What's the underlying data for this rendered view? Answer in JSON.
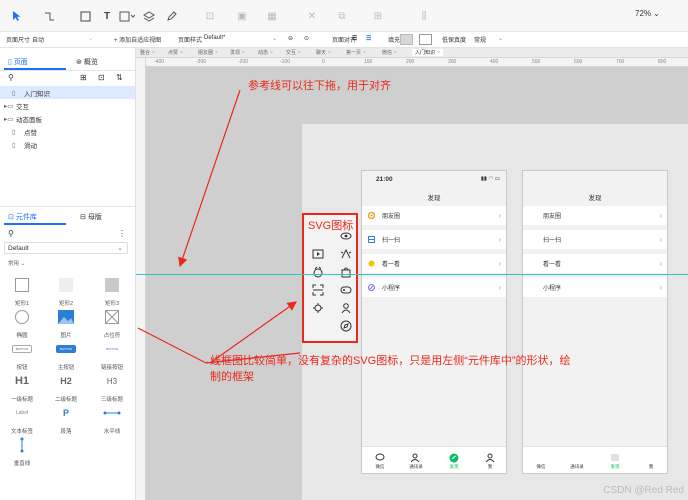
{
  "toolbar": {
    "zoom": "72%"
  },
  "propbar": {
    "page_size_label": "页面尺寸",
    "page_size_value": "自动",
    "add_adaptive_view": "+ 添加自适应视图",
    "page_style_label": "页面样式",
    "page_style_value": "Default*",
    "page_align_label": "页面对齐",
    "fill_label": "填充",
    "low_fidelity_label": "低保真度",
    "low_fidelity_value": "常规"
  },
  "left": {
    "tab_pages": "页面",
    "tab_outline": "概览",
    "tree": [
      {
        "label": "入门知识",
        "indent": 1,
        "selected": true,
        "kind": "page"
      },
      {
        "label": "交互",
        "indent": 0,
        "selected": false,
        "kind": "folder"
      },
      {
        "label": "动态面板",
        "indent": 0,
        "selected": false,
        "kind": "folder"
      },
      {
        "label": "点赞",
        "indent": 1,
        "selected": false,
        "kind": "page"
      },
      {
        "label": "滑动",
        "indent": 1,
        "selected": false,
        "kind": "page"
      }
    ],
    "tab_library": "元件库",
    "tab_masters": "母版",
    "library_select": "Default",
    "section_common": "常用",
    "widgets": [
      "矩形1",
      "矩形2",
      "矩形3",
      "椭圆",
      "图片",
      "占位符",
      "按钮",
      "主按钮",
      "链接按钮",
      "一级标题",
      "二级标题",
      "三级标题",
      "文本标签",
      "段落",
      "水平线",
      "垂直线"
    ],
    "widget_glyphs": {
      "h1": "H1",
      "h2": "H2",
      "h3": "H3",
      "label": "Label",
      "para": "P",
      "btn": "BUTTON"
    }
  },
  "canvas": {
    "page_tabs": [
      "整合",
      "点赞",
      "朋友圈",
      "发现",
      "动态",
      "交互",
      "聊天",
      "第一页",
      "微信",
      "入门知识"
    ],
    "ruler_numbers": [
      "-400",
      "-300",
      "-200",
      "-100",
      "0",
      "100",
      "200",
      "300",
      "400",
      "500",
      "600",
      "700",
      "800"
    ],
    "annotation_top": "参考线可以往下拖，用于对齐",
    "annotation_bottom_line1": "线框图比较简单，没有复杂的SVG图标，只是用左侧“元件库中”的形状，绘",
    "annotation_bottom_line2": "制的框架",
    "svg_label": "SVG图标",
    "phone1": {
      "time": "21:00",
      "title": "发现",
      "rows": [
        "朋友圈",
        "扫一扫",
        "看一看",
        "小程序"
      ],
      "nav": [
        "微信",
        "通讯录",
        "发现",
        "我"
      ]
    },
    "phone2": {
      "title": "发现",
      "rows": [
        "朋友圈",
        "扫一扫",
        "看一看",
        "小程序"
      ],
      "nav": [
        "微信",
        "通讯录",
        "发现",
        "我"
      ]
    },
    "watermark": "CSDN @Red Red"
  },
  "colors": {
    "accent": "#1e6fff",
    "annotation": "#e8291c",
    "guide": "#2ec5ce",
    "green": "#07c160"
  }
}
